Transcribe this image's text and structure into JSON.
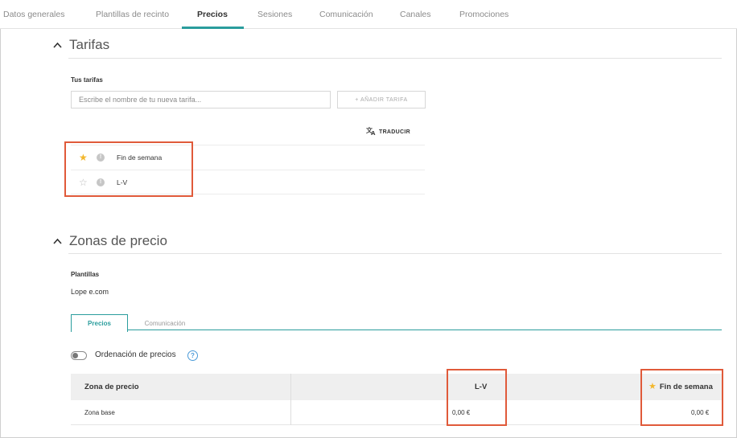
{
  "tabs": [
    {
      "label": "Datos generales"
    },
    {
      "label": "Plantillas de recinto"
    },
    {
      "label": "Precios"
    },
    {
      "label": "Sesiones"
    },
    {
      "label": "Comunicación"
    },
    {
      "label": "Canales"
    },
    {
      "label": "Promociones"
    }
  ],
  "active_tab": "Precios",
  "tarifas": {
    "title": "Tarifas",
    "label": "Tus tarifas",
    "input_placeholder": "Escribe el nombre de tu nueva tarifa...",
    "add_button": "+ AÑADIR TARIFA",
    "translate_button": "TRADUCIR",
    "items": [
      {
        "name": "Fin de semana",
        "favorite": true
      },
      {
        "name": "L-V",
        "favorite": false
      }
    ]
  },
  "zonas": {
    "title": "Zonas de precio",
    "plantillas_label": "Plantillas",
    "plantilla_value": "Lope e.com",
    "subtabs": [
      {
        "label": "Precios"
      },
      {
        "label": "Comunicación"
      }
    ],
    "toggle_label": "Ordenación de precios",
    "toggle_on": false,
    "table": {
      "headers": [
        "Zona de precio",
        "",
        "L-V",
        "Fin de semana"
      ],
      "rows": [
        {
          "zona": "Zona base",
          "lv": "0,00 €",
          "finde": "0,00 €"
        }
      ]
    }
  },
  "colors": {
    "accent": "#2a9d9d",
    "highlight": "#e05a3a",
    "star": "#f3b72c"
  }
}
